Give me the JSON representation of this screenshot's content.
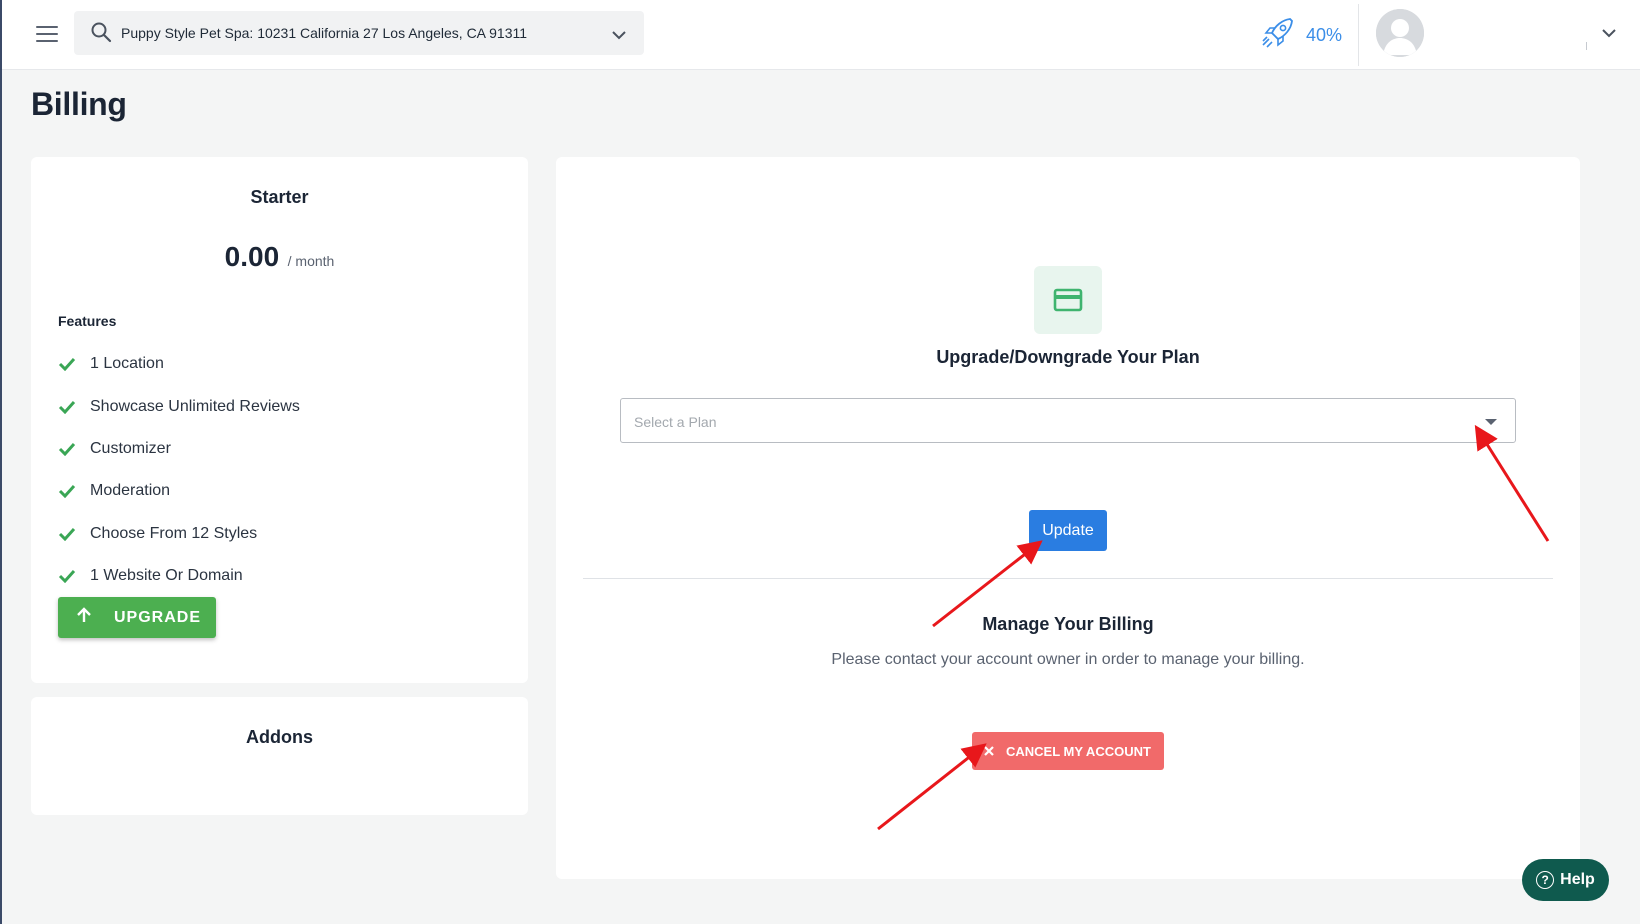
{
  "header": {
    "location_value": "Puppy Style Pet Spa: 10231 California 27 Los Angeles, CA 91311",
    "progress_percent": "40%",
    "icons": [
      "menu-icon",
      "search-icon",
      "chevron-down-icon",
      "rocket-icon",
      "avatar",
      "chevron-down-icon"
    ]
  },
  "page": {
    "title": "Billing"
  },
  "plan_card": {
    "name": "Starter",
    "price": "0.00",
    "period": "/ month",
    "features_title": "Features",
    "features": [
      "1 Location",
      "Showcase Unlimited Reviews",
      "Customizer",
      "Moderation",
      "Choose From 12 Styles",
      "1 Website Or Domain"
    ],
    "upgrade_label": "UPGRADE"
  },
  "addons_card": {
    "title": "Addons"
  },
  "billing": {
    "upgrade_title": "Upgrade/Downgrade Your Plan",
    "select_placeholder": "Select a Plan",
    "update_label": "Update",
    "manage_title": "Manage Your Billing",
    "manage_text": "Please contact your account owner in order to manage your billing.",
    "cancel_label": "CANCEL MY ACCOUNT"
  },
  "help": {
    "label": "Help"
  },
  "colors": {
    "accent_blue": "#2a7de1",
    "upgrade_green": "#4caf50",
    "cancel_red": "#f16a6a",
    "help_teal": "#0f5a4e",
    "annotation_arrow": "#e8171b"
  }
}
